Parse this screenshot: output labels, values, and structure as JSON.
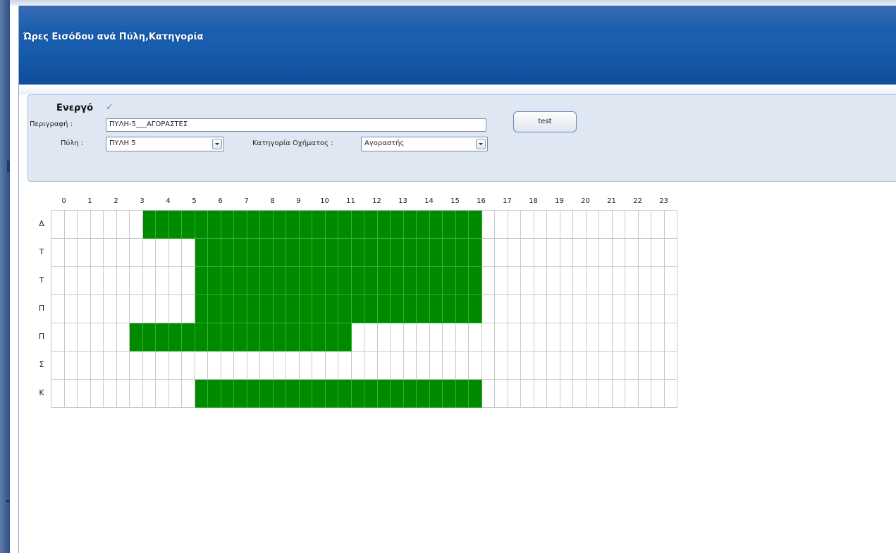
{
  "window": {
    "title": "Ώρες Εισόδου ανά Πύλη,Κατηγορία"
  },
  "form": {
    "active_label": "Ενεργό",
    "active_checked": true,
    "description_label": "Περιγραφή :",
    "description_value": "ΠΥΛΗ-5___ΑΓΟΡΑΣΤΕΣ",
    "gate_label": "Πύλη :",
    "gate_value": "ΠΥΛΗ 5",
    "category_label": "Κατηγορία Οχήματος :",
    "category_value": "Αγοραστής",
    "test_button_label": "test"
  },
  "schedule": {
    "hours": [
      "0",
      "1",
      "2",
      "3",
      "4",
      "5",
      "6",
      "7",
      "8",
      "9",
      "10",
      "11",
      "12",
      "13",
      "14",
      "15",
      "16",
      "17",
      "18",
      "19",
      "20",
      "21",
      "22",
      "23"
    ],
    "days": [
      "Δ",
      "Τ",
      "Τ",
      "Π",
      "Π",
      "Σ",
      "Κ"
    ],
    "half_hour_slots_per_day": 48,
    "active_ranges": [
      [
        [
          7,
          32
        ]
      ],
      [
        [
          11,
          32
        ]
      ],
      [
        [
          11,
          32
        ]
      ],
      [
        [
          11,
          32
        ]
      ],
      [
        [
          6,
          22
        ]
      ],
      [],
      [
        [
          11,
          32
        ]
      ]
    ]
  },
  "colors": {
    "active_cell": "#008a00",
    "title_bar": "#1a5fb0",
    "panel": "#dfe7f2"
  }
}
